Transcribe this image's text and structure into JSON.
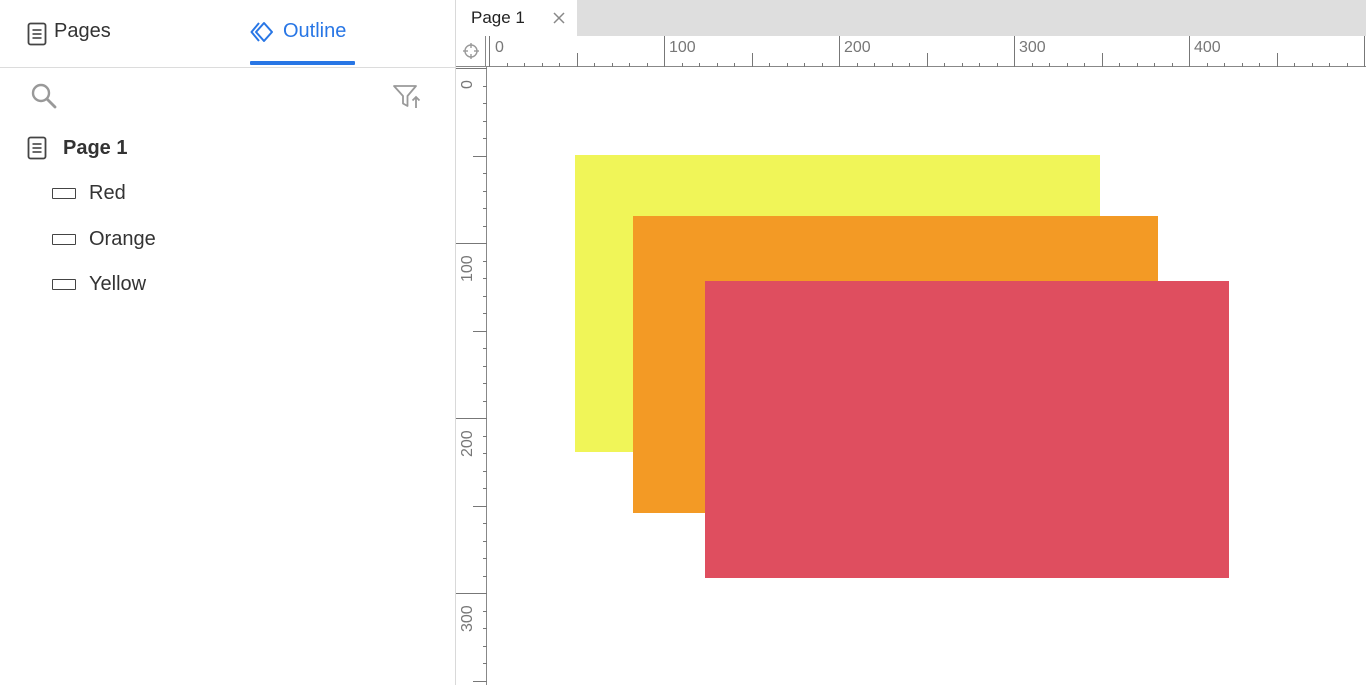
{
  "left_panel": {
    "tabs": {
      "pages": "Pages",
      "outline": "Outline"
    },
    "tree": {
      "page": "Page 1",
      "items": [
        {
          "label": "Red",
          "icon": "rectangle-icon"
        },
        {
          "label": "Orange",
          "icon": "rectangle-icon"
        },
        {
          "label": "Yellow",
          "icon": "rectangle-icon"
        }
      ]
    },
    "active_tab": "Outline"
  },
  "document": {
    "tab_title": "Page 1"
  },
  "rulers": {
    "horizontal": [
      "0",
      "100",
      "200",
      "300",
      "400"
    ],
    "vertical": [
      "0",
      "100",
      "200",
      "300"
    ]
  },
  "canvas": {
    "shapes": [
      {
        "name": "Yellow",
        "color": "#f0f558"
      },
      {
        "name": "Orange",
        "color": "#f39a25"
      },
      {
        "name": "Red",
        "color": "#df4e5f"
      }
    ]
  },
  "colors": {
    "accent": "#2876e5"
  }
}
